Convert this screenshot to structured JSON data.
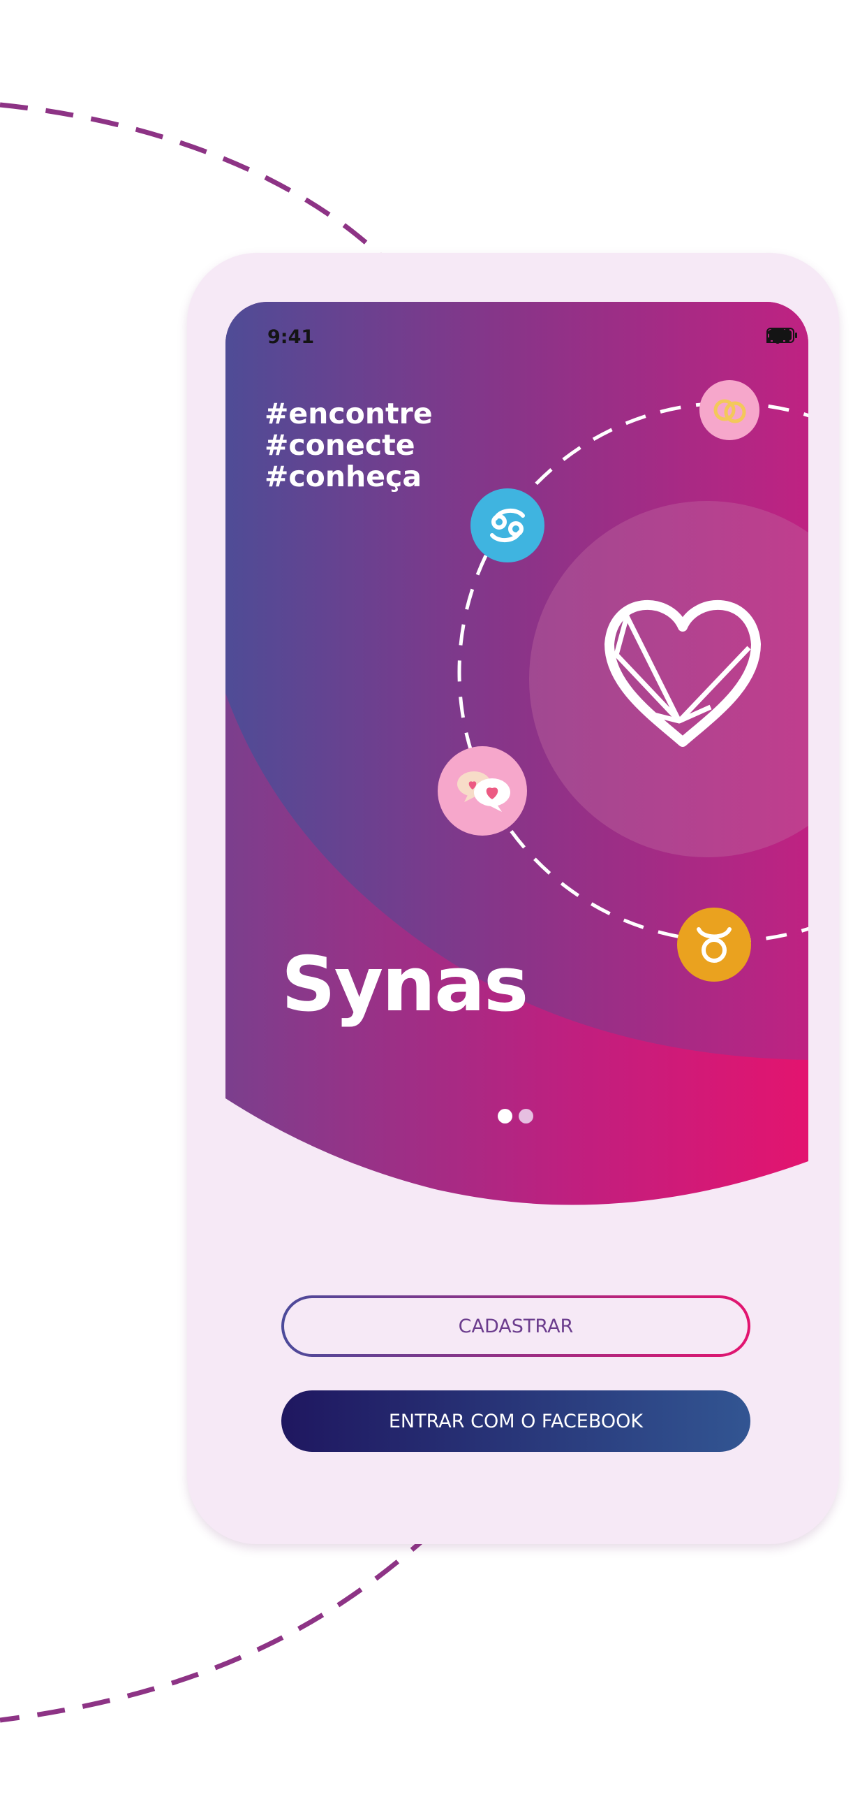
{
  "status_bar": {
    "time": "9:41"
  },
  "hero": {
    "hashtags": [
      "#encontre",
      "#conecte",
      "#conheça"
    ],
    "app_name": "Synas",
    "orbit_icons": [
      "cancer-zodiac-icon",
      "rings-icon",
      "chat-hearts-icon",
      "taurus-zodiac-icon"
    ],
    "center_icon": "heart-logo-icon"
  },
  "pagination": {
    "total": 2,
    "active": 1
  },
  "actions": {
    "register_label": "CADASTRAR",
    "facebook_label": "ENTRAR COM O FACEBOOK"
  },
  "colors": {
    "phone_background": "#f6e9f6",
    "gradient_start": "#4b4a9a",
    "gradient_end": "#e3146f",
    "facebook_start": "#1f1760",
    "facebook_end": "#325592",
    "cancer_icon_bg": "#3fb4e0",
    "taurus_icon_bg": "#eaa21f",
    "pink_icon_bg": "#f6a7cb",
    "orbit_dash": "#8d3385"
  }
}
